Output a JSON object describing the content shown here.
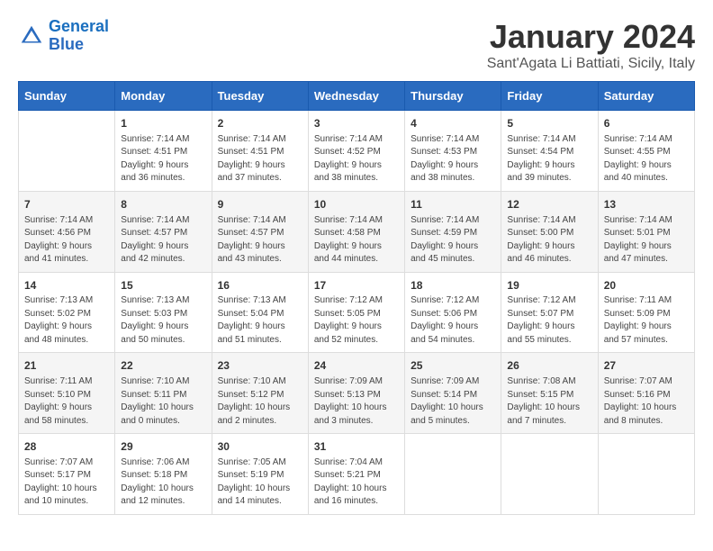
{
  "header": {
    "logo_line1": "General",
    "logo_line2": "Blue",
    "title": "January 2024",
    "subtitle": "Sant'Agata Li Battiati, Sicily, Italy"
  },
  "days_of_week": [
    "Sunday",
    "Monday",
    "Tuesday",
    "Wednesday",
    "Thursday",
    "Friday",
    "Saturday"
  ],
  "weeks": [
    [
      {
        "day": "",
        "info": ""
      },
      {
        "day": "1",
        "info": "Sunrise: 7:14 AM\nSunset: 4:51 PM\nDaylight: 9 hours\nand 36 minutes."
      },
      {
        "day": "2",
        "info": "Sunrise: 7:14 AM\nSunset: 4:51 PM\nDaylight: 9 hours\nand 37 minutes."
      },
      {
        "day": "3",
        "info": "Sunrise: 7:14 AM\nSunset: 4:52 PM\nDaylight: 9 hours\nand 38 minutes."
      },
      {
        "day": "4",
        "info": "Sunrise: 7:14 AM\nSunset: 4:53 PM\nDaylight: 9 hours\nand 38 minutes."
      },
      {
        "day": "5",
        "info": "Sunrise: 7:14 AM\nSunset: 4:54 PM\nDaylight: 9 hours\nand 39 minutes."
      },
      {
        "day": "6",
        "info": "Sunrise: 7:14 AM\nSunset: 4:55 PM\nDaylight: 9 hours\nand 40 minutes."
      }
    ],
    [
      {
        "day": "7",
        "info": "Sunrise: 7:14 AM\nSunset: 4:56 PM\nDaylight: 9 hours\nand 41 minutes."
      },
      {
        "day": "8",
        "info": "Sunrise: 7:14 AM\nSunset: 4:57 PM\nDaylight: 9 hours\nand 42 minutes."
      },
      {
        "day": "9",
        "info": "Sunrise: 7:14 AM\nSunset: 4:57 PM\nDaylight: 9 hours\nand 43 minutes."
      },
      {
        "day": "10",
        "info": "Sunrise: 7:14 AM\nSunset: 4:58 PM\nDaylight: 9 hours\nand 44 minutes."
      },
      {
        "day": "11",
        "info": "Sunrise: 7:14 AM\nSunset: 4:59 PM\nDaylight: 9 hours\nand 45 minutes."
      },
      {
        "day": "12",
        "info": "Sunrise: 7:14 AM\nSunset: 5:00 PM\nDaylight: 9 hours\nand 46 minutes."
      },
      {
        "day": "13",
        "info": "Sunrise: 7:14 AM\nSunset: 5:01 PM\nDaylight: 9 hours\nand 47 minutes."
      }
    ],
    [
      {
        "day": "14",
        "info": "Sunrise: 7:13 AM\nSunset: 5:02 PM\nDaylight: 9 hours\nand 48 minutes."
      },
      {
        "day": "15",
        "info": "Sunrise: 7:13 AM\nSunset: 5:03 PM\nDaylight: 9 hours\nand 50 minutes."
      },
      {
        "day": "16",
        "info": "Sunrise: 7:13 AM\nSunset: 5:04 PM\nDaylight: 9 hours\nand 51 minutes."
      },
      {
        "day": "17",
        "info": "Sunrise: 7:12 AM\nSunset: 5:05 PM\nDaylight: 9 hours\nand 52 minutes."
      },
      {
        "day": "18",
        "info": "Sunrise: 7:12 AM\nSunset: 5:06 PM\nDaylight: 9 hours\nand 54 minutes."
      },
      {
        "day": "19",
        "info": "Sunrise: 7:12 AM\nSunset: 5:07 PM\nDaylight: 9 hours\nand 55 minutes."
      },
      {
        "day": "20",
        "info": "Sunrise: 7:11 AM\nSunset: 5:09 PM\nDaylight: 9 hours\nand 57 minutes."
      }
    ],
    [
      {
        "day": "21",
        "info": "Sunrise: 7:11 AM\nSunset: 5:10 PM\nDaylight: 9 hours\nand 58 minutes."
      },
      {
        "day": "22",
        "info": "Sunrise: 7:10 AM\nSunset: 5:11 PM\nDaylight: 10 hours\nand 0 minutes."
      },
      {
        "day": "23",
        "info": "Sunrise: 7:10 AM\nSunset: 5:12 PM\nDaylight: 10 hours\nand 2 minutes."
      },
      {
        "day": "24",
        "info": "Sunrise: 7:09 AM\nSunset: 5:13 PM\nDaylight: 10 hours\nand 3 minutes."
      },
      {
        "day": "25",
        "info": "Sunrise: 7:09 AM\nSunset: 5:14 PM\nDaylight: 10 hours\nand 5 minutes."
      },
      {
        "day": "26",
        "info": "Sunrise: 7:08 AM\nSunset: 5:15 PM\nDaylight: 10 hours\nand 7 minutes."
      },
      {
        "day": "27",
        "info": "Sunrise: 7:07 AM\nSunset: 5:16 PM\nDaylight: 10 hours\nand 8 minutes."
      }
    ],
    [
      {
        "day": "28",
        "info": "Sunrise: 7:07 AM\nSunset: 5:17 PM\nDaylight: 10 hours\nand 10 minutes."
      },
      {
        "day": "29",
        "info": "Sunrise: 7:06 AM\nSunset: 5:18 PM\nDaylight: 10 hours\nand 12 minutes."
      },
      {
        "day": "30",
        "info": "Sunrise: 7:05 AM\nSunset: 5:19 PM\nDaylight: 10 hours\nand 14 minutes."
      },
      {
        "day": "31",
        "info": "Sunrise: 7:04 AM\nSunset: 5:21 PM\nDaylight: 10 hours\nand 16 minutes."
      },
      {
        "day": "",
        "info": ""
      },
      {
        "day": "",
        "info": ""
      },
      {
        "day": "",
        "info": ""
      }
    ]
  ]
}
